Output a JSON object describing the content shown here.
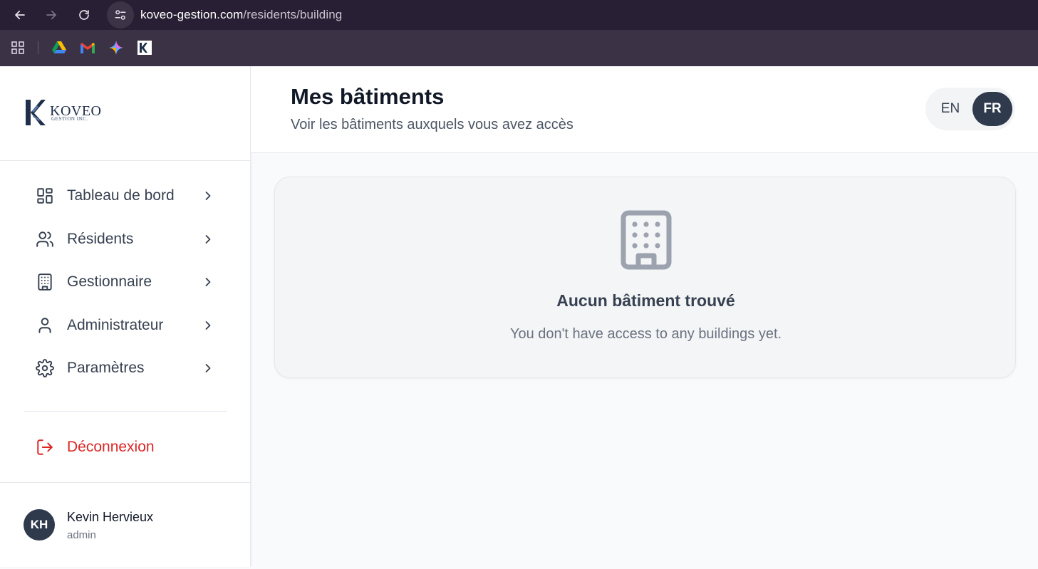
{
  "browser": {
    "url_domain": "koveo-gestion.com",
    "url_path": "/residents/building"
  },
  "sidebar": {
    "logo": {
      "name": "KOVEO",
      "subtitle": "GESTION INC."
    },
    "items": [
      {
        "label": "Tableau de bord",
        "icon": "dashboard-grid-icon"
      },
      {
        "label": "Résidents",
        "icon": "users-icon"
      },
      {
        "label": "Gestionnaire",
        "icon": "building-icon"
      },
      {
        "label": "Administrateur",
        "icon": "user-icon"
      },
      {
        "label": "Paramètres",
        "icon": "gear-icon"
      }
    ],
    "logout_label": "Déconnexion",
    "user": {
      "initials": "KH",
      "name": "Kevin Hervieux",
      "role": "admin"
    }
  },
  "header": {
    "title": "Mes bâtiments",
    "subtitle": "Voir les bâtiments auxquels vous avez accès",
    "lang_options": [
      "EN",
      "FR"
    ],
    "lang_selected": "FR"
  },
  "empty_state": {
    "icon": "building-icon",
    "title": "Aucun bâtiment trouvé",
    "message": "You don't have access to any buildings yet."
  },
  "colors": {
    "primary": "#2f3a4d",
    "danger": "#dc2626",
    "chrome_dark": "#281f34"
  }
}
